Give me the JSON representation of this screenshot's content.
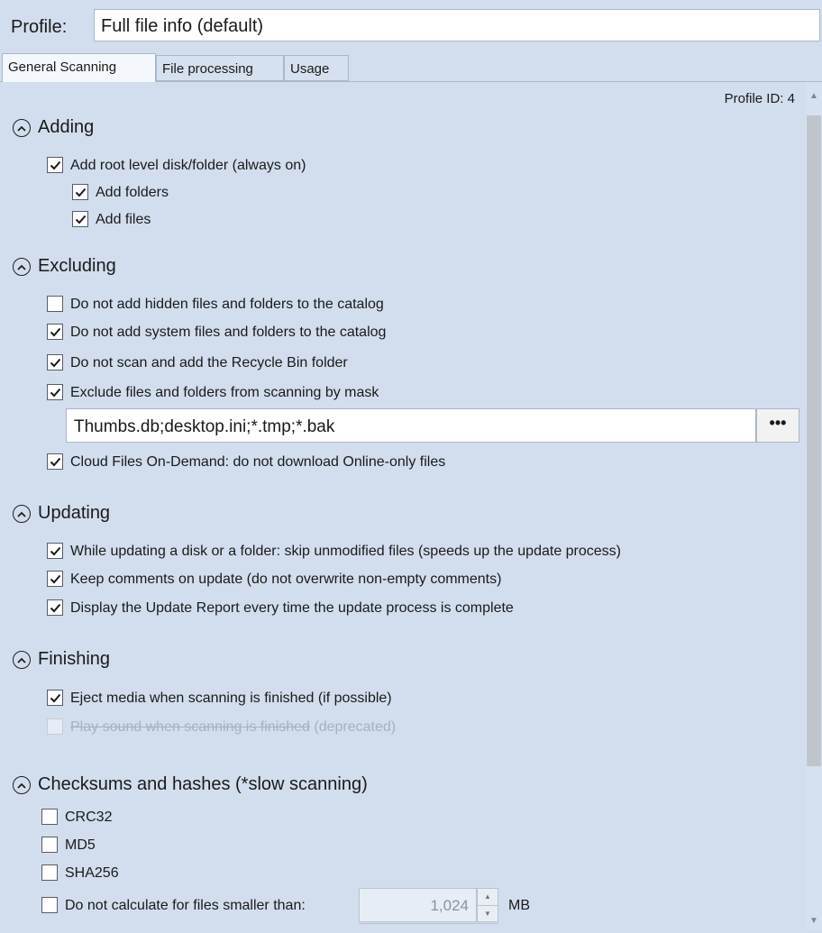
{
  "profile": {
    "label": "Profile:",
    "value": "Full file info (default)"
  },
  "tabs": [
    "General Scanning",
    "File processing",
    "Usage"
  ],
  "profile_id": "Profile ID: 4",
  "sections": {
    "adding": {
      "title": "Adding",
      "items": [
        {
          "label": "Add root level disk/folder (always on)",
          "checked": true
        },
        {
          "label": "Add folders",
          "checked": true
        },
        {
          "label": "Add files",
          "checked": true
        }
      ]
    },
    "excluding": {
      "title": "Excluding",
      "items": [
        {
          "label": "Do not add hidden files and folders to the catalog",
          "checked": false
        },
        {
          "label": "Do not add system files and folders to the catalog",
          "checked": true
        },
        {
          "label": "Do not scan and add the Recycle Bin folder",
          "checked": true
        },
        {
          "label": "Exclude files and folders from scanning by mask",
          "checked": true
        },
        {
          "label": "Cloud Files On-Demand: do not download Online-only files",
          "checked": true
        }
      ],
      "mask_value": "Thumbs.db;desktop.ini;*.tmp;*.bak",
      "mask_button": "•••"
    },
    "updating": {
      "title": "Updating",
      "items": [
        {
          "label": "While updating a disk or a folder: skip unmodified files (speeds up the update process)",
          "checked": true
        },
        {
          "label": "Keep comments on update (do not overwrite non-empty comments)",
          "checked": true
        },
        {
          "label": "Display the Update Report every time the update process is complete",
          "checked": true
        }
      ]
    },
    "finishing": {
      "title": "Finishing",
      "items": [
        {
          "label": "Eject media when scanning is finished (if possible)",
          "checked": true
        },
        {
          "label": "Play sound when scanning is finished",
          "suffix": "(deprecated)",
          "checked": false,
          "disabled": true
        }
      ]
    },
    "checksums": {
      "title": "Checksums and hashes (*slow scanning)",
      "items": [
        {
          "label": "CRC32",
          "checked": false
        },
        {
          "label": "MD5",
          "checked": false
        },
        {
          "label": "SHA256",
          "checked": false
        },
        {
          "label": "Do not calculate for files smaller than:",
          "checked": false
        }
      ],
      "min_size_value": "1,024",
      "min_size_unit": "MB"
    }
  }
}
